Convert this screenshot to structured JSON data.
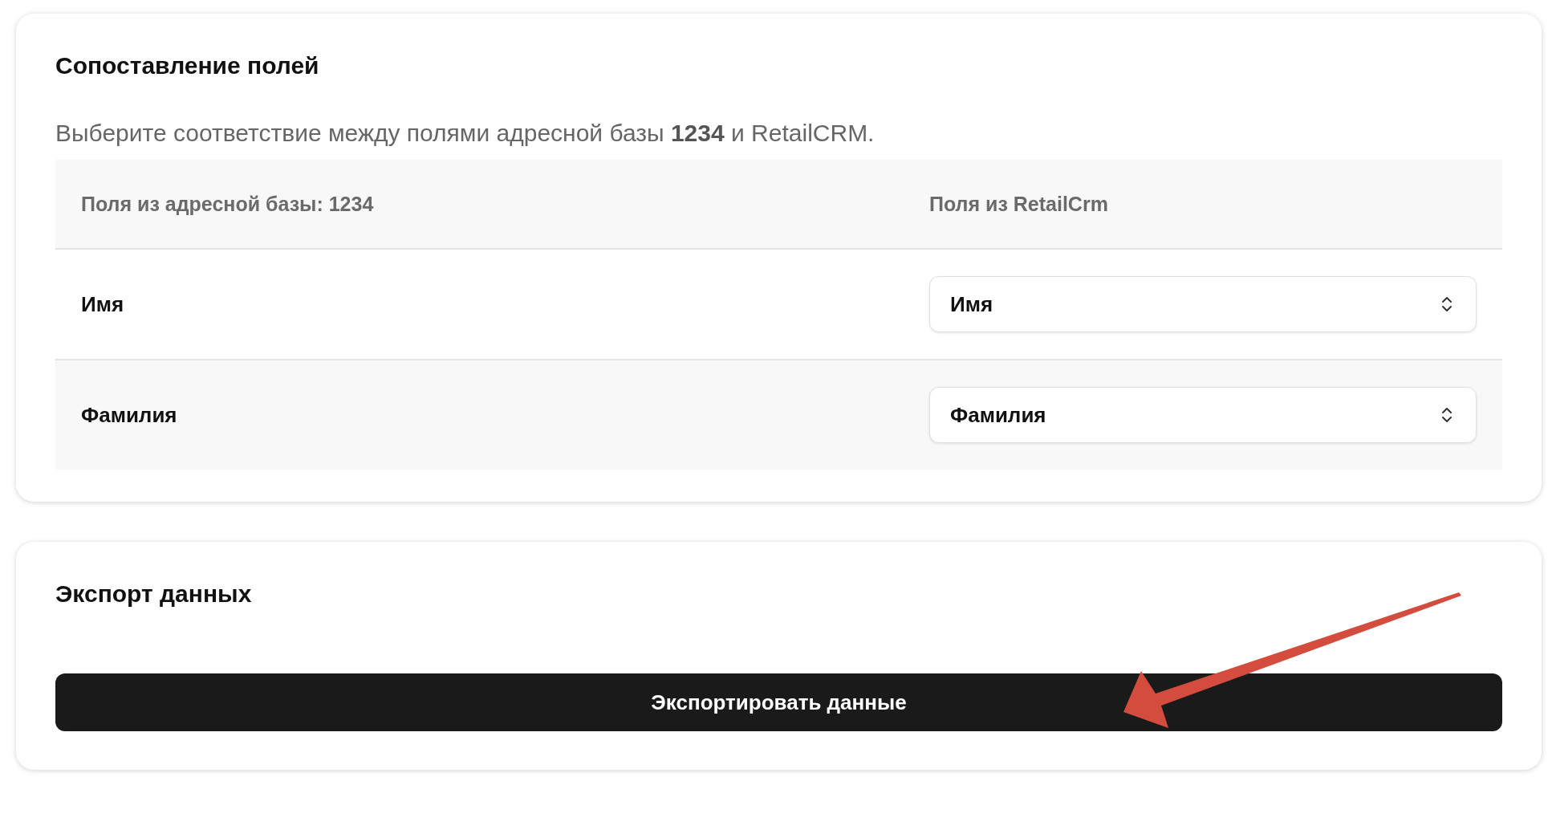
{
  "mapping_card": {
    "title": "Сопоставление полей",
    "description": "Выберите соответствие между полями адресной базы **1234** и RetailCRM.",
    "table": {
      "columns": [
        "Поля из адресной базы: 1234",
        "Поля из RetailCrm"
      ],
      "rows": [
        {
          "field": "Имя",
          "value": "Имя"
        },
        {
          "field": "Фамилия",
          "value": "Фамилия"
        }
      ]
    }
  },
  "export_card": {
    "title": "Экспорт данных",
    "button": "Экспортировать данные"
  }
}
